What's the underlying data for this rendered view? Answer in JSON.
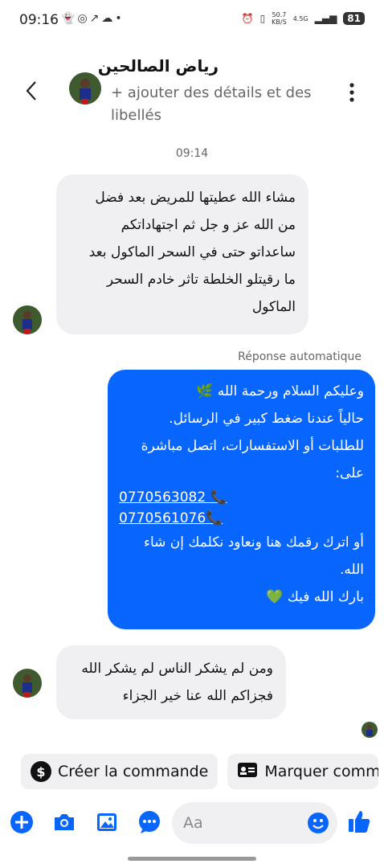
{
  "status": {
    "time": "09:16",
    "left_icons": [
      "snapchat-icon",
      "messenger-icon",
      "missed-call-icon",
      "cloud-icon",
      "dot-icon"
    ],
    "speed_value": "50.7",
    "speed_unit": "KB/S",
    "network": "4.5G",
    "battery": "81"
  },
  "header": {
    "name": "رياض الصالحين",
    "subtitle": "+ ajouter des détails et des libellés"
  },
  "timestamp": "09:14",
  "messages": {
    "incoming1": {
      "lines": [
        "مشاء الله عطيتها للمريض بعد فضل",
        "من الله عز و جل ثم اجتهاداتكم",
        "ساعداتو حتى في السحر الماكول بعد",
        "ما رقيتلو الخلطة تاثر خادم السحر",
        "الماكول"
      ]
    },
    "auto_label": "Réponse automatique",
    "outgoing": {
      "line1": "وعليكم السلام ورحمة الله 🌿",
      "line2": "حالياً عندنا ضغط كبير في الرسائل.",
      "line3": "للطلبات أو الاستفسارات، اتصل مباشرة",
      "line4": "على:",
      "phone1": "0770563082",
      "phone2": "0770561076",
      "line5": "أو اترك رقمك هنا ونعاود نكلمك إن شاء",
      "line6": "الله.",
      "line7": "بارك الله فيك 💚"
    },
    "incoming2": {
      "lines": [
        "ومن لم يشكر الناس لم يشكر الله",
        "فجزاكم الله عنا خير الجزاء"
      ]
    }
  },
  "actions": {
    "create_order": "Créer la commande",
    "mark": "Marquer comme"
  },
  "composer": {
    "placeholder": "Aa"
  },
  "colors": {
    "accent": "#0866ff",
    "bubble_incoming": "#f0f0f2"
  }
}
